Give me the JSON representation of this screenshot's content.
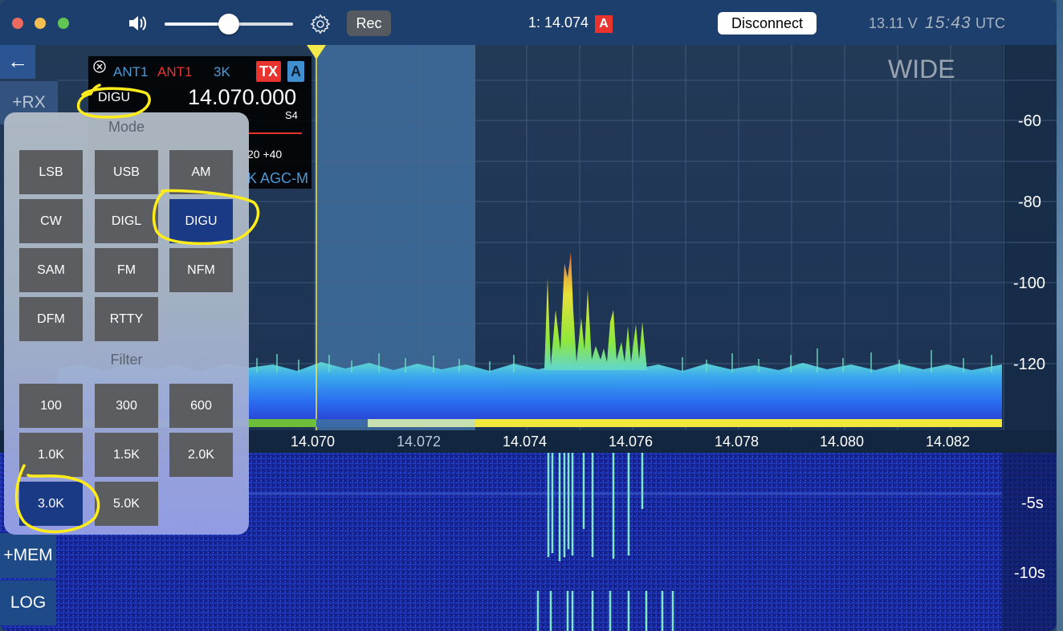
{
  "titlebar": {
    "rec_label": "Rec",
    "frequency": "1: 14.074",
    "vfo_badge": "A",
    "disconnect_label": "Disconnect",
    "voltage": "13.11 V",
    "time": "15:43",
    "timezone": "UTC",
    "volume_level": 0.5
  },
  "sidebar": {
    "back_label": "←",
    "rx_label": "+RX",
    "mem_label": "+MEM",
    "log_label": "LOG"
  },
  "slice": {
    "ant_rx": "ANT1",
    "ant_tx": "ANT1",
    "filter": "3K",
    "tx_label": "TX",
    "slice_letter": "A",
    "mode": "DIGU",
    "frequency": "14.070.000",
    "s_meter": "S4",
    "meter_ticks": "20 +40",
    "agc": "K AGC-M"
  },
  "spectrum": {
    "view_label": "WIDE",
    "db_labels": [
      "-60",
      "-80",
      "-100",
      "-120"
    ],
    "freq_labels": [
      "14.070",
      "14.072",
      "14.074",
      "14.076",
      "14.078",
      "14.080",
      "14.082"
    ],
    "time_labels": [
      "-5s",
      "-10s"
    ]
  },
  "popup": {
    "mode_title": "Mode",
    "modes": [
      "LSB",
      "USB",
      "AM",
      "CW",
      "DIGL",
      "DIGU",
      "SAM",
      "FM",
      "NFM",
      "DFM",
      "RTTY"
    ],
    "selected_mode": "DIGU",
    "filter_title": "Filter",
    "filters": [
      "100",
      "300",
      "600",
      "1.0K",
      "1.5K",
      "2.0K",
      "3.0K",
      "5.0K"
    ],
    "selected_filter": "3.0K"
  },
  "colors": {
    "accent_blue": "#1b3a85",
    "tx_red": "#e8332f",
    "annotation": "#ffec1a"
  }
}
